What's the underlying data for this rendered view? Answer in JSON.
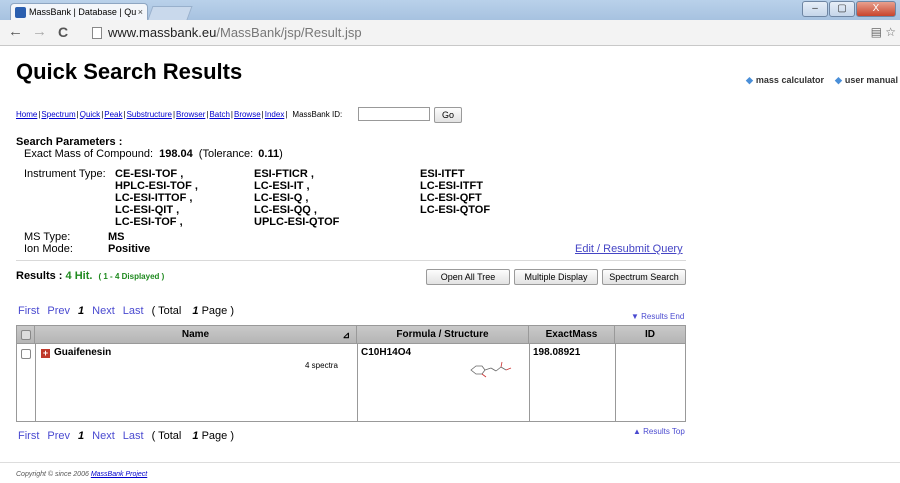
{
  "browser": {
    "tab_title": "MassBank | Database | Qu",
    "tab_close": "×",
    "url_host": "www.massbank.eu",
    "url_path": "/MassBank/jsp/Result.jsp",
    "back_icon": "←",
    "forward_icon": "→",
    "reload_icon": "C",
    "addr_icons": "▤ ☆",
    "window_buttons": [
      "–",
      "▢",
      "X"
    ]
  },
  "page": {
    "title": "Quick Search Results",
    "links": {
      "mass_calculator": "mass calculator",
      "user_manual": "user manual"
    }
  },
  "nav": {
    "items": [
      "Home",
      "Spectrum",
      "Quick",
      "Peak",
      "Substructure",
      "Browser",
      "Batch",
      "Browse",
      "Index"
    ],
    "mbid_label": "MassBank ID:",
    "go_label": "Go"
  },
  "search_params": {
    "title": "Search Parameters :",
    "exact_mass_label": "Exact Mass of Compound:",
    "exact_mass_value": "198.04",
    "tolerance_label": "(Tolerance:",
    "tolerance_value": "0.11",
    "tolerance_close": ")",
    "instrument_label": "Instrument Type:",
    "instrument_col1": [
      "CE-ESI-TOF ,",
      "HPLC-ESI-TOF ,",
      "LC-ESI-ITTOF ,",
      "LC-ESI-QIT ,",
      "LC-ESI-TOF ,"
    ],
    "instrument_col2": [
      "ESI-FTICR ,",
      "LC-ESI-IT ,",
      "LC-ESI-Q ,",
      "LC-ESI-QQ ,",
      "UPLC-ESI-QTOF"
    ],
    "instrument_col3": [
      "ESI-ITFT",
      "LC-ESI-ITFT",
      "LC-ESI-QFT",
      "LC-ESI-QTOF"
    ],
    "ms_type_label": "MS Type:",
    "ms_type_value": "MS",
    "ion_mode_label": "Ion Mode:",
    "ion_mode_value": "Positive",
    "edit_link": "Edit / Resubmit Query"
  },
  "results": {
    "label": "Results :",
    "hits": "4 Hit.",
    "displayed": "( 1 - 4 Displayed )",
    "buttons": {
      "open_all_tree": "Open All Tree",
      "multiple_display": "Multiple Display",
      "spectrum_search": "Spectrum Search"
    },
    "pager": {
      "first": "First",
      "prev": "Prev",
      "current": "1",
      "next": "Next",
      "last": "Last",
      "total_prefix": "( Total",
      "total_pages": "1",
      "total_suffix": "Page )"
    },
    "results_end": "▼ Results End",
    "results_top": "▲ Results Top",
    "columns": [
      "Name",
      "Formula / Structure",
      "ExactMass",
      "ID"
    ],
    "sort_icon": "⊿",
    "rows": [
      {
        "expander": "+",
        "name": "Guaifenesin",
        "spectra": "4 spectra",
        "formula": "C10H14O4",
        "exact_mass": "198.08921",
        "id": ""
      }
    ]
  },
  "footer": {
    "copyright_prefix": "Copyright © since 2006",
    "copyright_link": "MassBank Project"
  }
}
